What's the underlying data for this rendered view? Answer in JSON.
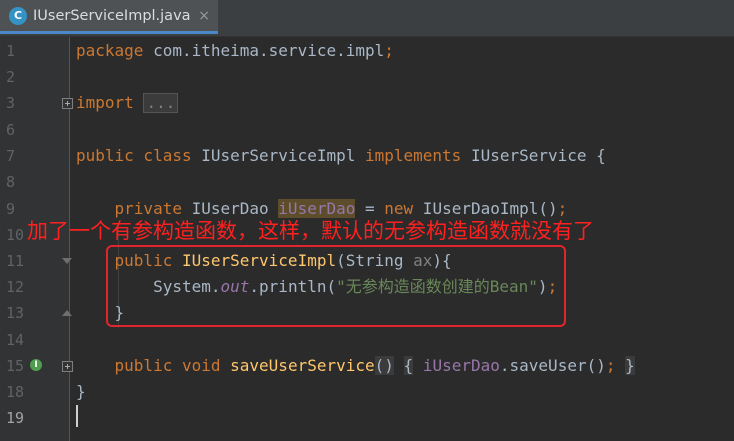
{
  "tab": {
    "icon_letter": "C",
    "title": "IUserServiceImpl.java",
    "close": "×"
  },
  "lines": [
    {
      "n": "1"
    },
    {
      "n": "2"
    },
    {
      "n": "3"
    },
    {
      "n": "6"
    },
    {
      "n": "7"
    },
    {
      "n": "8"
    },
    {
      "n": "9"
    },
    {
      "n": "10"
    },
    {
      "n": "11"
    },
    {
      "n": "12"
    },
    {
      "n": "13"
    },
    {
      "n": "14"
    },
    {
      "n": "15"
    },
    {
      "n": "18"
    },
    {
      "n": "19"
    }
  ],
  "code": {
    "l1_kw": "package",
    "l1_rest": " com.itheima.service.impl",
    "l1_semi": ";",
    "l3_kw": "import",
    "l3_fold": "...",
    "l7_kw1": "public class",
    "l7_cls": " IUserServiceImpl ",
    "l7_kw2": "implements",
    "l7_rest": " IUserService {",
    "l9_kw": "private",
    "l9_type": " IUserDao ",
    "l9_field": "iUserDao",
    "l9_eq": " = ",
    "l9_new": "new",
    "l9_rest": " IUserDaoImpl()",
    "l9_semi": ";",
    "l11_kw": "public",
    "l11_fn": "IUserServiceImpl",
    "l11_open": "(String ",
    "l11_param": "ax",
    "l11_close": "){",
    "l12_cls": "System.",
    "l12_stat": "out",
    "l12_call": ".println(",
    "l12_str": "\"无参构造函数创建的Bean\"",
    "l12_close": ")",
    "l12_semi": ";",
    "l13_brace": "}",
    "l15_kw": "public void",
    "l15_fn": "saveUserService",
    "l15_parens": "()",
    "l15_lb": "{",
    "l15_field": "iUserDao",
    "l15_call": ".saveUser()",
    "l15_semi": ";",
    "l15_rb": "}",
    "l18_brace": "}"
  },
  "gutter": {
    "impl_icon": "up-arrow-implements-icon",
    "impl_glyph": "I"
  },
  "annotation": {
    "text": "加了一个有参构造函数，这样，默认的无参构造函数就没有了",
    "color": "#ff2020",
    "box_color": "#e0262a"
  },
  "theme": {
    "background": "#2b2b2b",
    "keyword": "#cc7832",
    "string": "#6a8759",
    "field": "#9876aa",
    "method": "#ffc66d"
  }
}
